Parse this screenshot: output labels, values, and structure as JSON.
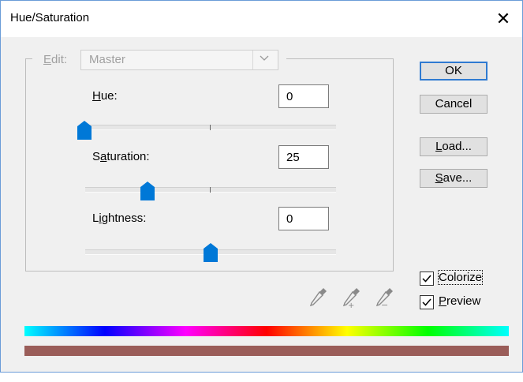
{
  "window": {
    "title": "Hue/Saturation",
    "close_glyph": "✕"
  },
  "edit": {
    "label_prefix": "E",
    "label_rest": "dit:",
    "selected": "Master",
    "chevron": "⌵"
  },
  "hue": {
    "label_u": "H",
    "label_rest": "ue:",
    "value": "0",
    "level": 0
  },
  "saturation": {
    "label_pre": "S",
    "label_u": "a",
    "label_rest": "turation:",
    "value": "25",
    "level": 0.25
  },
  "lightness": {
    "label_pre": "L",
    "label_u": "i",
    "label_rest": "ghtness:",
    "value": "0",
    "level": 0
  },
  "buttons": {
    "ok": "OK",
    "cancel": "Cancel",
    "load_u": "L",
    "load_rest": "oad...",
    "save_u": "S",
    "save_rest": "ave..."
  },
  "colorize": {
    "label": "Colorize",
    "checked": true
  },
  "preview": {
    "label_u": "P",
    "label_rest": "review",
    "checked": true
  },
  "tools": [
    "eyedropper-icon",
    "eyedropper-plus-icon",
    "eyedropper-minus-icon"
  ],
  "colors": {
    "accent": "#0078d7",
    "result_bar": "#9a5d59"
  }
}
